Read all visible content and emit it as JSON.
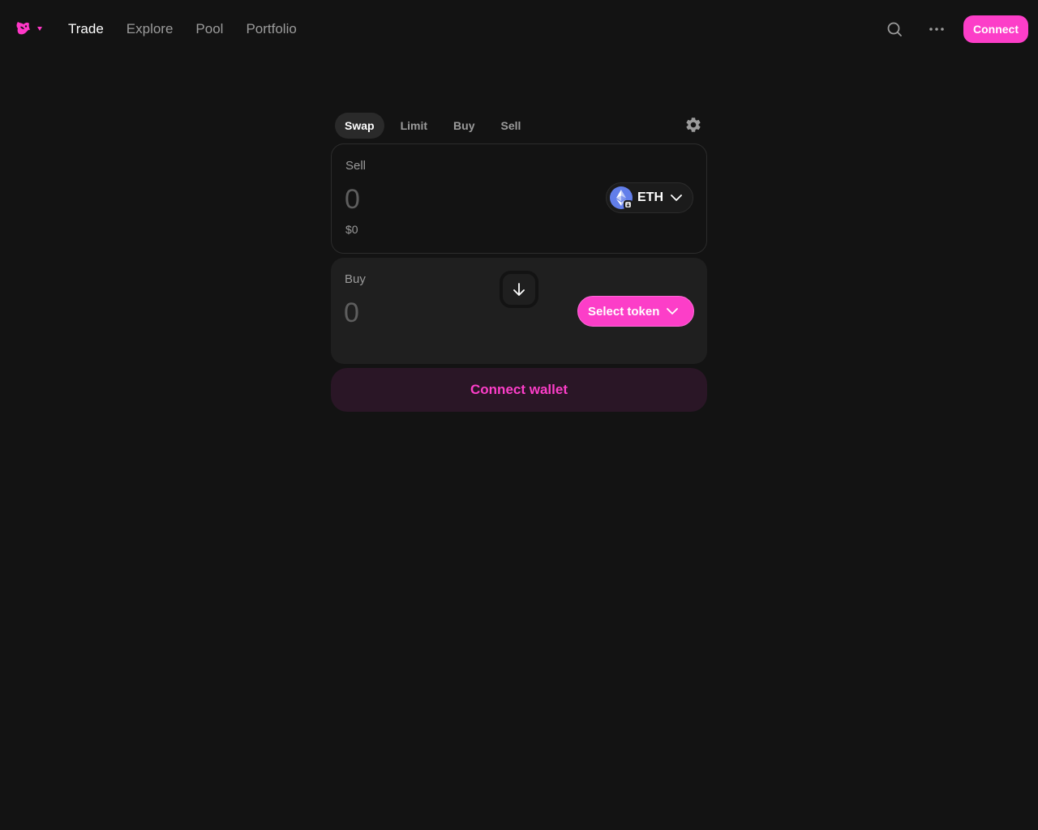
{
  "nav": {
    "links": [
      "Trade",
      "Explore",
      "Pool",
      "Portfolio"
    ],
    "active": "Trade",
    "connect_label": "Connect"
  },
  "swap": {
    "tabs": [
      "Swap",
      "Limit",
      "Buy",
      "Sell"
    ],
    "active_tab": "Swap",
    "sell": {
      "label": "Sell",
      "amount_placeholder": "0",
      "usd_value": "$0",
      "token": "ETH"
    },
    "buy": {
      "label": "Buy",
      "amount_placeholder": "0",
      "select_token_label": "Select token"
    },
    "connect_wallet_label": "Connect wallet"
  },
  "colors": {
    "background": "#131313",
    "accent": "#fc3ec8",
    "panel": "#1f1f1f",
    "muted_text": "#9b9b9b",
    "connect_wallet_bg": "#2a1626"
  },
  "icons": [
    "uniswap-logo",
    "chevron-down-icon",
    "search-icon",
    "more-icon",
    "gear-icon",
    "eth-icon",
    "arrow-down-icon"
  ]
}
